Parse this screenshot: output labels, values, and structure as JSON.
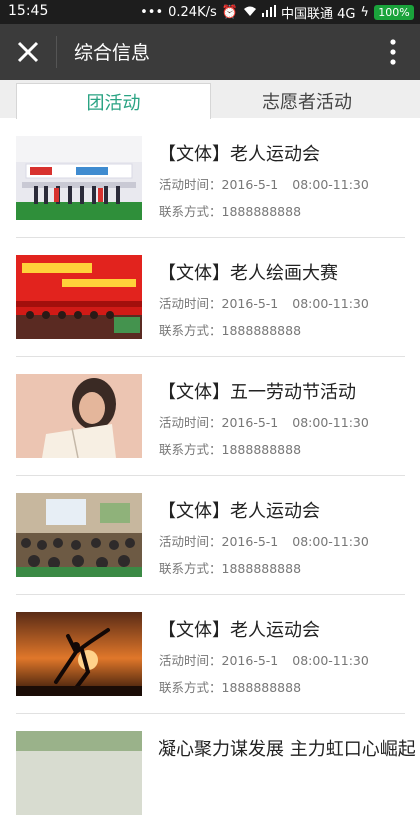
{
  "status": {
    "time": "15:45",
    "speed": "0.24K/s",
    "carrier": "中国联通 4G",
    "battery": "100%"
  },
  "header": {
    "title": "综合信息",
    "close_icon": "close-icon",
    "more_icon": "more-vertical-icon"
  },
  "tabs": [
    {
      "label": "团活动",
      "active": true
    },
    {
      "label": "志愿者活动",
      "active": false
    }
  ],
  "colors": {
    "accent": "#2aa383",
    "appbar": "#3b3b3b",
    "statusbar": "#1d1d1d"
  },
  "items": [
    {
      "title": "【文体】老人运动会",
      "time_label": "活动时间：",
      "date": "2016-5-1",
      "hours": "08:00-11:30",
      "contact_label": "联系方式：",
      "phone": "1888888888"
    },
    {
      "title": "【文体】老人绘画大赛",
      "time_label": "活动时间：",
      "date": "2016-5-1",
      "hours": "08:00-11:30",
      "contact_label": "联系方式：",
      "phone": "1888888888"
    },
    {
      "title": "【文体】五一劳动节活动",
      "time_label": "活动时间：",
      "date": "2016-5-1",
      "hours": "08:00-11:30",
      "contact_label": "联系方式：",
      "phone": "1888888888"
    },
    {
      "title": "【文体】老人运动会",
      "time_label": "活动时间：",
      "date": "2016-5-1",
      "hours": "08:00-11:30",
      "contact_label": "联系方式：",
      "phone": "1888888888"
    },
    {
      "title": "【文体】老人运动会",
      "time_label": "活动时间：",
      "date": "2016-5-1",
      "hours": "08:00-11:30",
      "contact_label": "联系方式：",
      "phone": "1888888888"
    },
    {
      "title": "凝心聚力谋发展 主力虹口心崛起"
    }
  ]
}
